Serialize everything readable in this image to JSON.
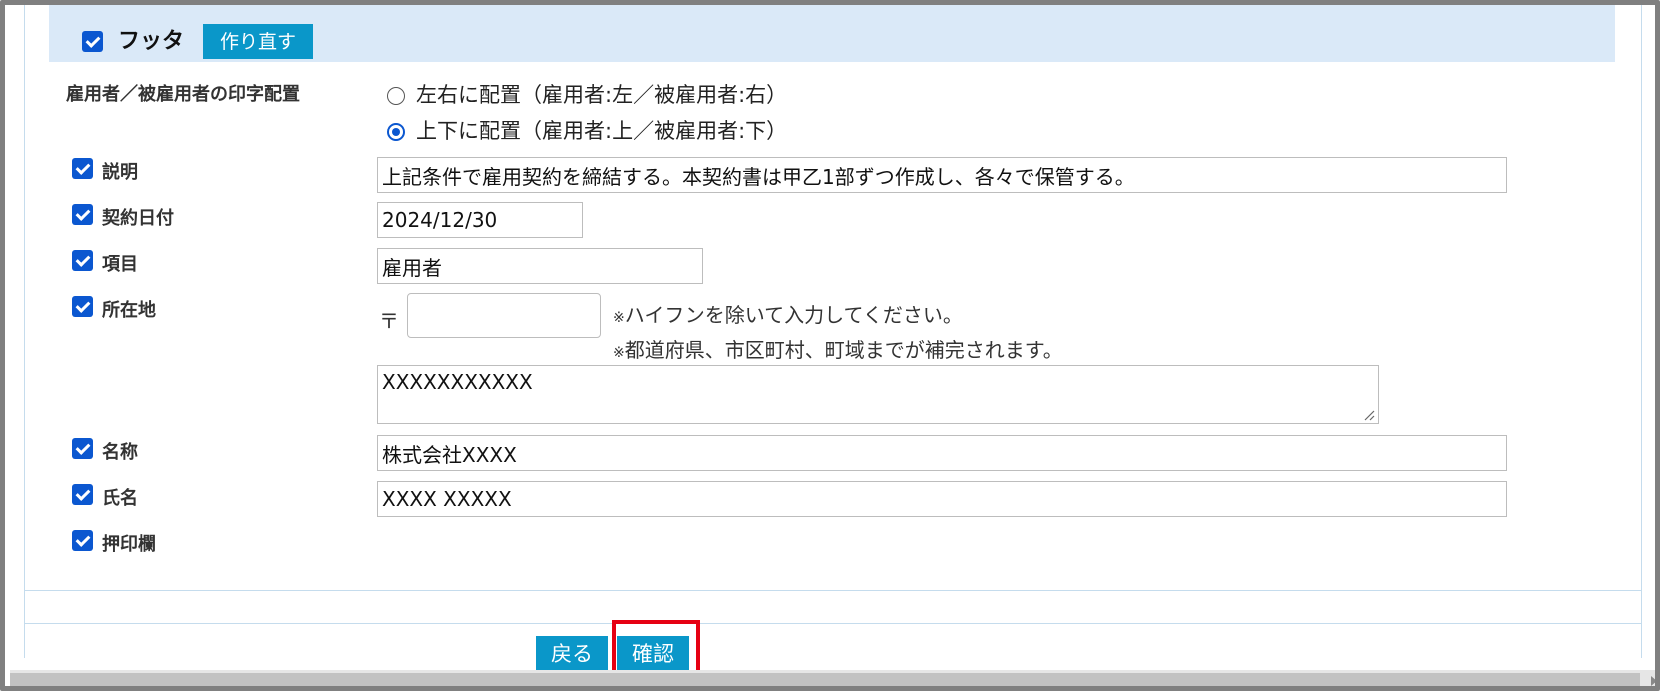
{
  "footer": {
    "title": "フッタ",
    "rebuild_label": "作り直す",
    "checked": true
  },
  "layout_option": {
    "label": "雇用者／被雇用者の印字配置",
    "options": [
      {
        "label": "左右に配置（雇用者:左／被雇用者:右）",
        "selected": false
      },
      {
        "label": "上下に配置（雇用者:上／被雇用者:下）",
        "selected": true
      }
    ]
  },
  "fields": {
    "description": {
      "label": "説明",
      "value": "上記条件で雇用契約を締結する。本契約書は甲乙1部ずつ作成し、各々で保管する。",
      "checked": true
    },
    "contract_date": {
      "label": "契約日付",
      "value": "2024/12/30",
      "checked": true
    },
    "item": {
      "label": "項目",
      "value": "雇用者",
      "checked": true
    },
    "address": {
      "label": "所在地",
      "postal_mark": "〒",
      "postal_value": "",
      "note1_mark": "※",
      "note1": "ハイフンを除いて入力してください。",
      "note2_mark": "※",
      "note2": "都道府県、市区町村、町域までが補完されます。",
      "value": "XXXXXXXXXXX",
      "checked": true
    },
    "name": {
      "label": "名称",
      "value": "株式会社XXXX",
      "checked": true
    },
    "person": {
      "label": "氏名",
      "value": "XXXX XXXXX",
      "checked": true
    },
    "seal": {
      "label": "押印欄",
      "checked": true
    }
  },
  "actions": {
    "back_label": "戻る",
    "confirm_label": "確認"
  },
  "colors": {
    "accent": "#0a97c9",
    "checkbox": "#0b57d0",
    "header_bg": "#dae9f8",
    "highlight": "#e60012"
  }
}
